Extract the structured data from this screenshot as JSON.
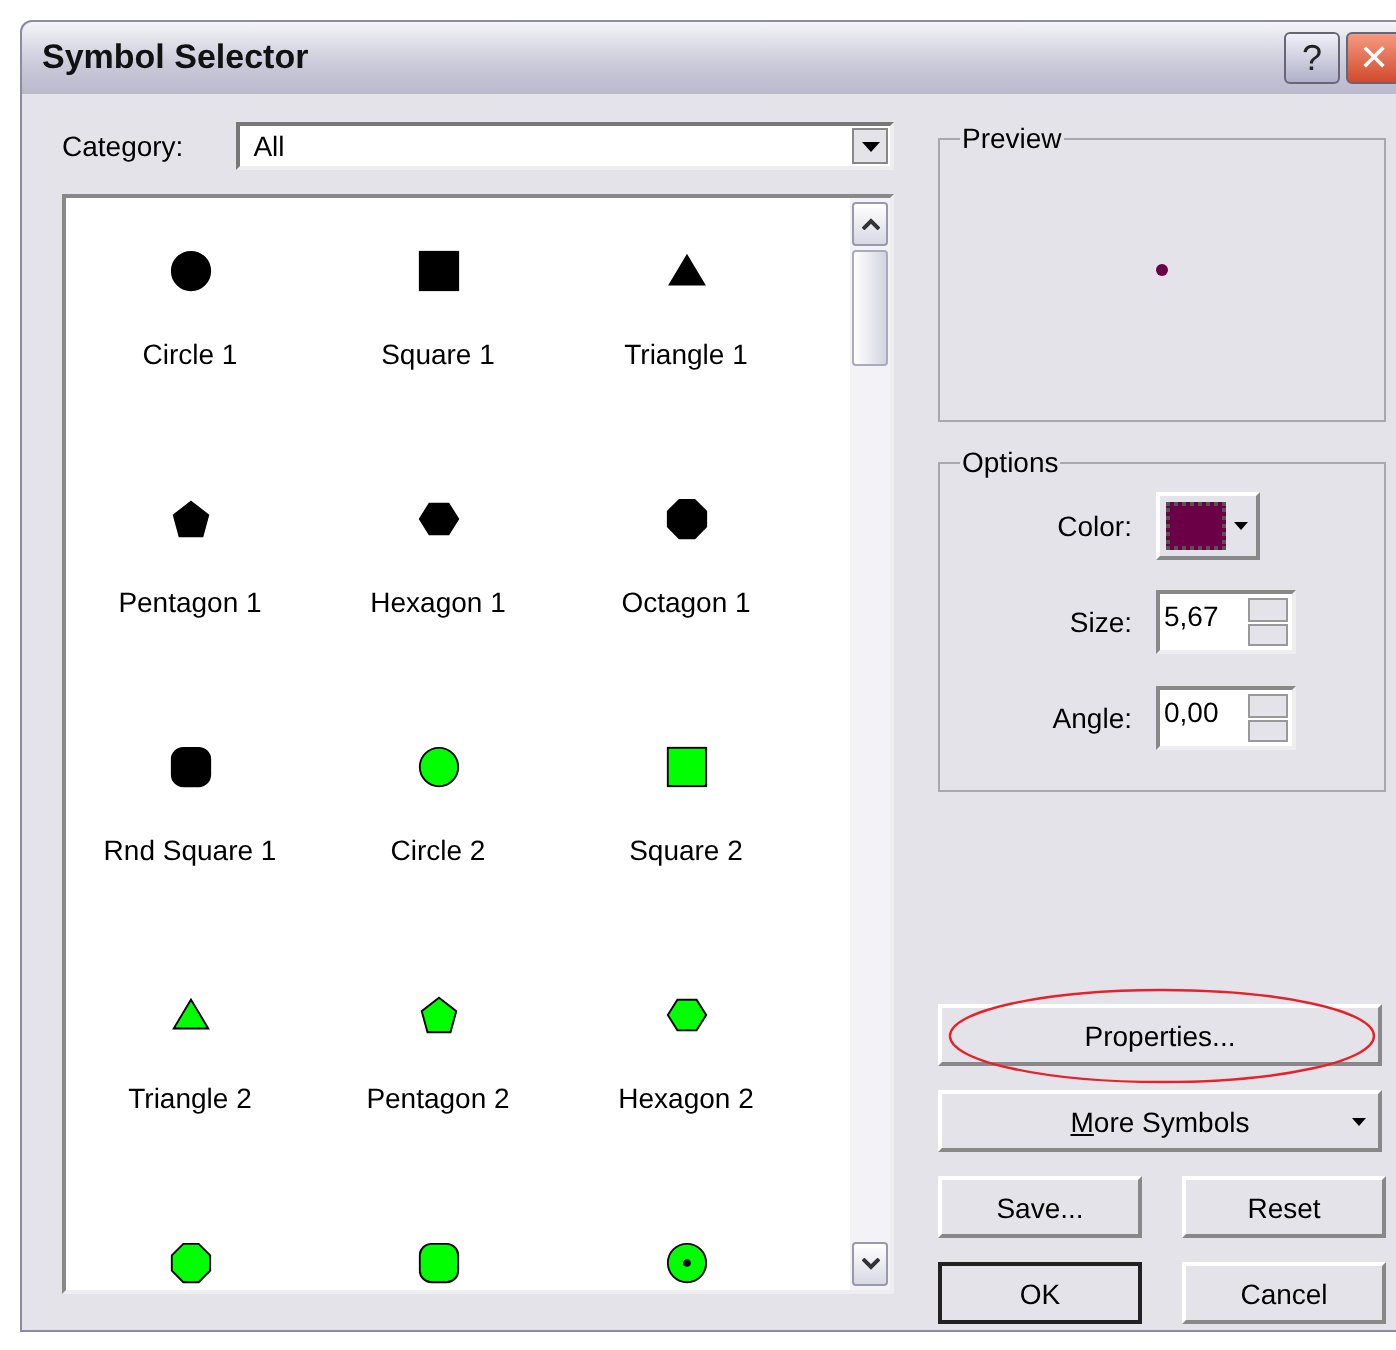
{
  "window": {
    "title": "Symbol Selector",
    "title_buttons": [
      "?",
      "✕"
    ]
  },
  "category": {
    "label": "Category:",
    "value": "All"
  },
  "symbols": [
    {
      "label": "Circle 1",
      "kind": "circle",
      "color": "#000000"
    },
    {
      "label": "Square 1",
      "kind": "square",
      "color": "#000000"
    },
    {
      "label": "Triangle 1",
      "kind": "triangle",
      "color": "#000000"
    },
    {
      "label": "Pentagon 1",
      "kind": "pentagon",
      "color": "#000000"
    },
    {
      "label": "Hexagon 1",
      "kind": "hexagon",
      "color": "#000000"
    },
    {
      "label": "Octagon 1",
      "kind": "octagon",
      "color": "#000000"
    },
    {
      "label": "Rnd Square 1",
      "kind": "rnd-square",
      "color": "#000000"
    },
    {
      "label": "Circle 2",
      "kind": "circle",
      "color": "#00ff00"
    },
    {
      "label": "Square 2",
      "kind": "square",
      "color": "#00ff00"
    },
    {
      "label": "Triangle 2",
      "kind": "triangle",
      "color": "#00ff00"
    },
    {
      "label": "Pentagon 2",
      "kind": "pentagon",
      "color": "#00ff00"
    },
    {
      "label": "Hexagon 2",
      "kind": "hexagon",
      "color": "#00ff00"
    },
    {
      "kind": "octagon",
      "color": "#00ff00"
    },
    {
      "kind": "rnd-square",
      "color": "#00ff00"
    },
    {
      "kind": "circle-dot",
      "color": "#00ff00"
    }
  ],
  "preview": {
    "title": "Preview",
    "color": "#6b0046"
  },
  "options": {
    "title": "Options",
    "color_label": "Color:",
    "color": "#6b0046",
    "size_label": "Size:",
    "size": "5,67",
    "angle_label": "Angle:",
    "angle": "0,00"
  },
  "buttons": {
    "properties": {
      "label": "Properties...",
      "highlighted": true
    },
    "more_symbols": {
      "label": "More Symbols",
      "mnemonic_underlined": true
    },
    "save": "Save...",
    "reset": "Reset",
    "ok": "OK",
    "cancel": "Cancel"
  }
}
